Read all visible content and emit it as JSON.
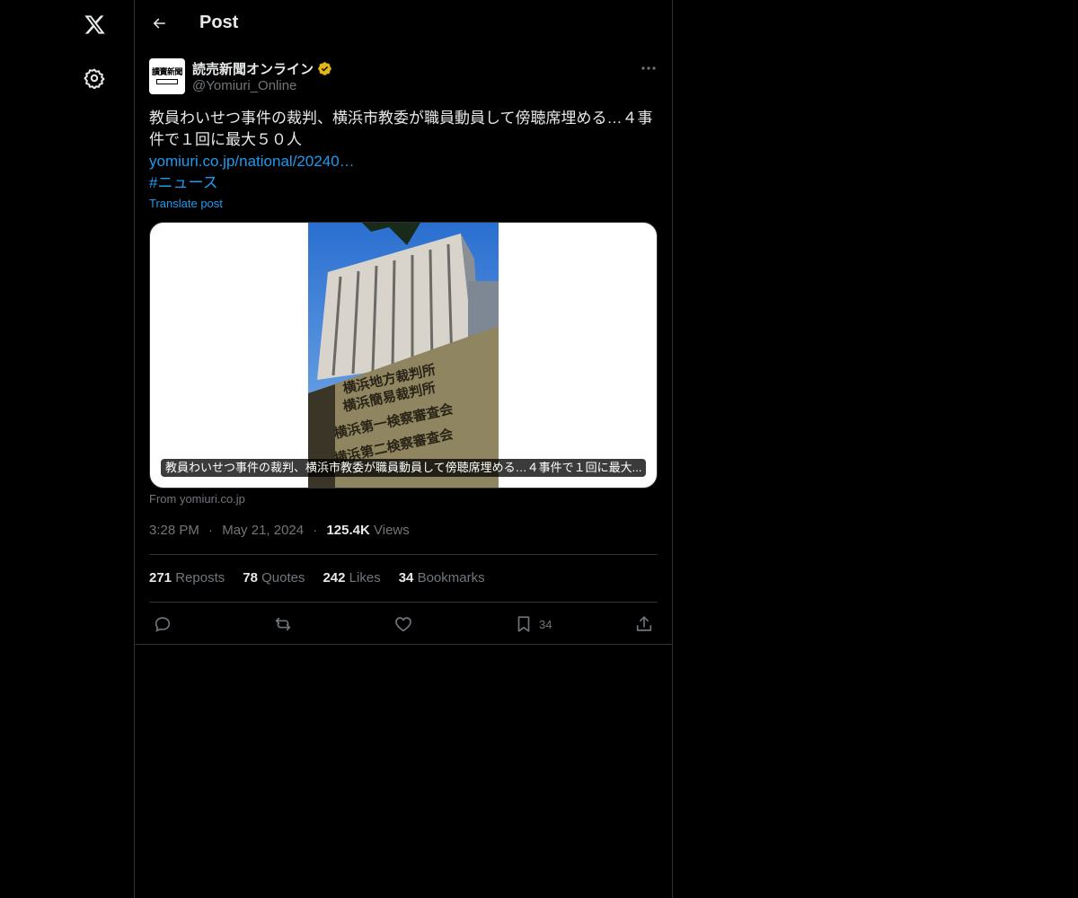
{
  "nav": {
    "logo_icon": "x-logo-icon",
    "settings_icon": "gear-icon"
  },
  "header": {
    "title": "Post",
    "back_icon": "arrow-left-icon"
  },
  "post": {
    "author": {
      "name": "読売新聞オンライン",
      "handle": "@Yomiuri_Online",
      "verified": true,
      "badge_color": "#e2b719",
      "avatar_text": "讀賣新聞"
    },
    "text_line": "教員わいせつ事件の裁判、横浜市教委が職員動員して傍聴席埋める…４事件で１回に最大５０人",
    "link": "yomiuri.co.jp/national/20240…",
    "hashtag": "#ニュース",
    "translate_label": "Translate post",
    "card": {
      "caption": "教員わいせつ事件の裁判、横浜市教委が職員動員して傍聴席埋める…４事件で１回に最大...",
      "source": "From yomiuri.co.jp"
    },
    "time": "3:28 PM",
    "date": "May 21, 2024",
    "views_count": "125.4K",
    "views_label": "Views",
    "separator": "·"
  },
  "stats": {
    "reposts_count": "271",
    "reposts_label": "Reposts",
    "quotes_count": "78",
    "quotes_label": "Quotes",
    "likes_count": "242",
    "likes_label": "Likes",
    "bookmarks_count": "34",
    "bookmarks_label": "Bookmarks"
  },
  "actions": {
    "reply_icon": "reply-icon",
    "repost_icon": "repost-icon",
    "like_icon": "heart-icon",
    "bookmark_icon": "bookmark-icon",
    "bookmark_count": "34",
    "share_icon": "share-icon"
  },
  "colors": {
    "background": "#000000",
    "text": "#e7e9ea",
    "secondary": "#71767b",
    "accent": "#1d9bf0",
    "border": "#2f3336"
  }
}
